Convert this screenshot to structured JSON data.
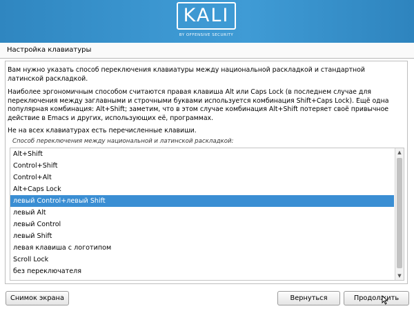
{
  "banner": {
    "logo_text": "KALI",
    "logo_subtitle": "BY OFFENSIVE SECURITY"
  },
  "page": {
    "title": "Настройка клавиатуры"
  },
  "content": {
    "paragraph1": "Вам нужно указать способ переключения клавиатуры между национальной раскладкой и стандартной латинской раскладкой.",
    "paragraph2": "Наиболее эргономичным способом считаются правая клавиша Alt или Caps Lock (в последнем случае для переключения между заглавными и строчными буквами используется комбинация Shift+Caps Lock). Ещё одна популярная комбинация: Alt+Shift; заметим, что в этом случае комбинация Alt+Shift потеряет своё привычное действие в Emacs и других, использующих её, программах.",
    "paragraph3": "Не на всех клавиатурах есть перечисленные клавиши.",
    "list_caption": "Способ переключения между национальной и латинской раскладкой:"
  },
  "list": {
    "items": [
      "Alt+Shift",
      "Control+Shift",
      "Control+Alt",
      "Alt+Caps Lock",
      "левый Control+левый Shift",
      "левый Alt",
      "левый Control",
      "левый Shift",
      "левая клавиша с логотипом",
      "Scroll Lock",
      "без переключателя"
    ],
    "selected_index": 4
  },
  "buttons": {
    "screenshot": "Снимок экрана",
    "back": "Вернуться",
    "continue": "Продолжить"
  },
  "colors": {
    "banner": "#3c97d1",
    "selection": "#3a8ed3"
  }
}
